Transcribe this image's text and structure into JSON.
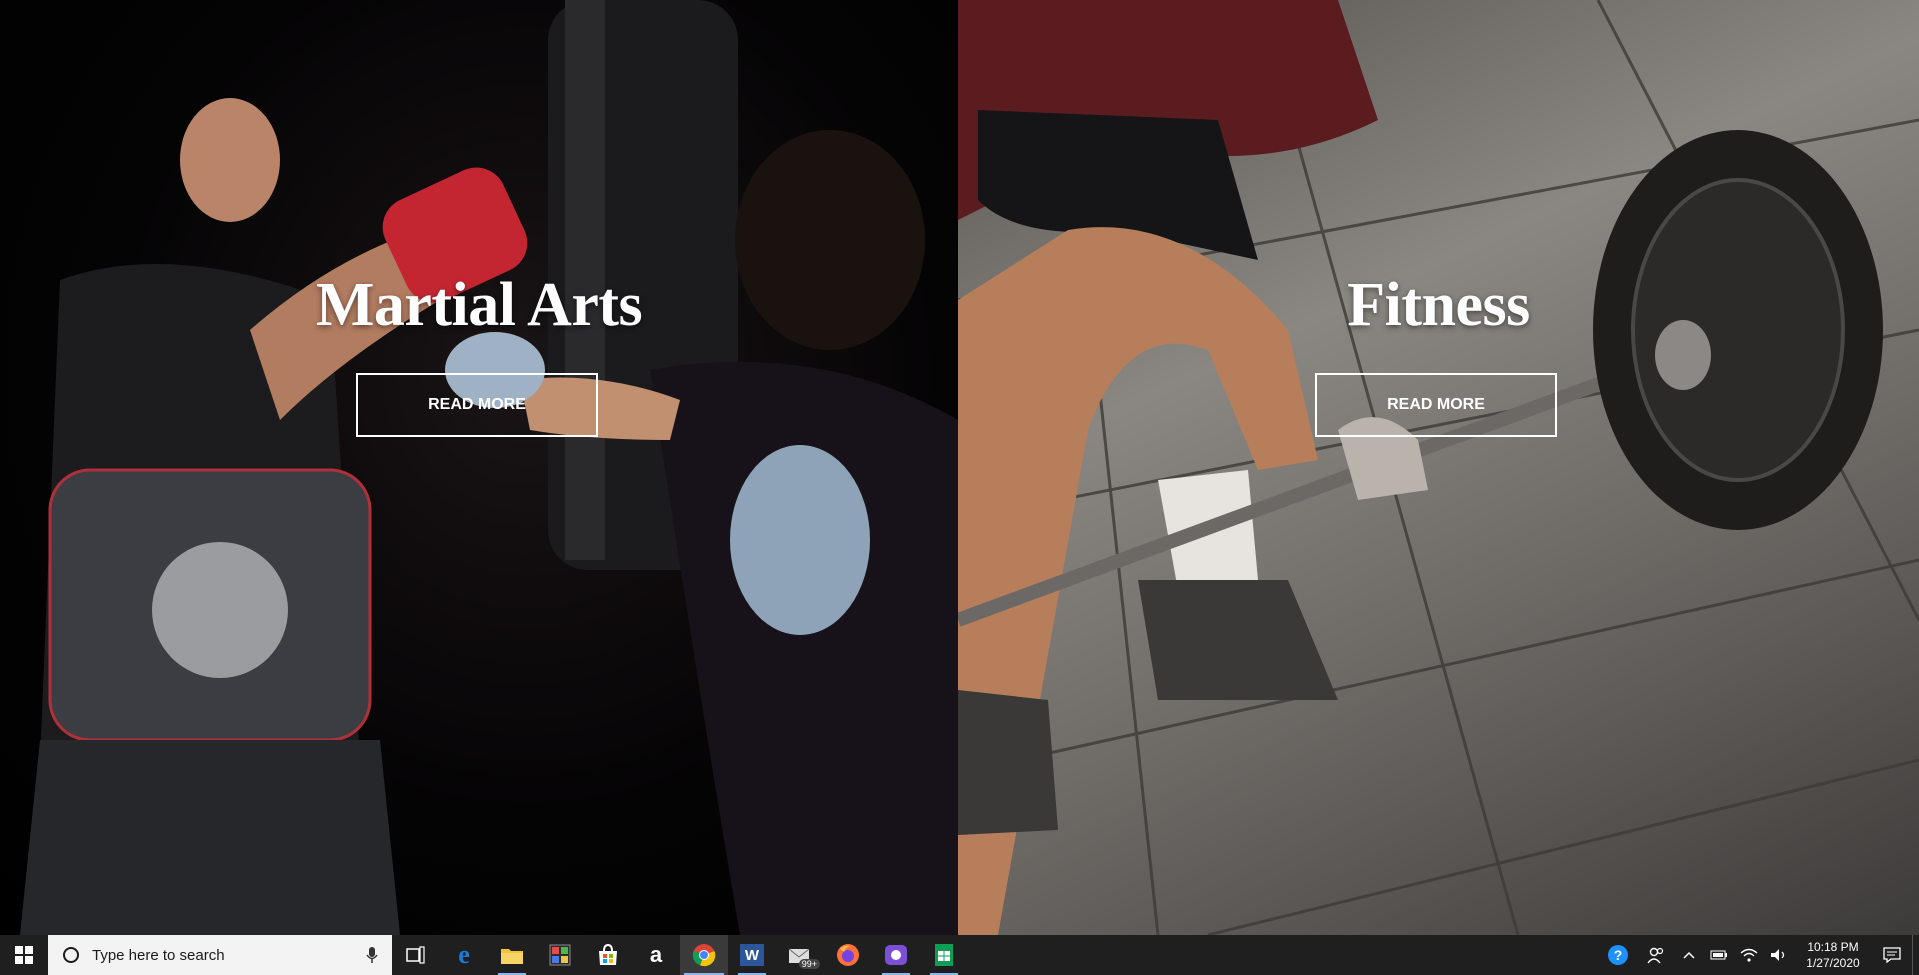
{
  "panels": [
    {
      "title": "Martial Arts",
      "button": "READ MORE"
    },
    {
      "title": "Fitness",
      "button": "READ MORE"
    }
  ],
  "taskbar": {
    "search_placeholder": "Type here to search",
    "apps": [
      {
        "name": "task-view",
        "icon": "task-view-icon"
      },
      {
        "name": "edge",
        "icon": "edge-icon"
      },
      {
        "name": "file-explorer",
        "icon": "folder-icon"
      },
      {
        "name": "photos",
        "icon": "photos-icon"
      },
      {
        "name": "store",
        "icon": "store-icon"
      },
      {
        "name": "amazon",
        "icon": "amazon-icon",
        "label": "a"
      },
      {
        "name": "chrome",
        "icon": "chrome-icon"
      },
      {
        "name": "word",
        "icon": "word-icon",
        "label": "W"
      },
      {
        "name": "mail",
        "icon": "mail-icon",
        "badge": "99+"
      },
      {
        "name": "firefox",
        "icon": "firefox-icon"
      },
      {
        "name": "app-purple",
        "icon": "app-icon"
      },
      {
        "name": "sheets",
        "icon": "spreadsheet-icon"
      }
    ],
    "clock": {
      "time": "10:18 PM",
      "date": "1/27/2020"
    }
  },
  "colors": {
    "taskbar": "#1f1f1f",
    "accent": "#8ab4f8"
  }
}
